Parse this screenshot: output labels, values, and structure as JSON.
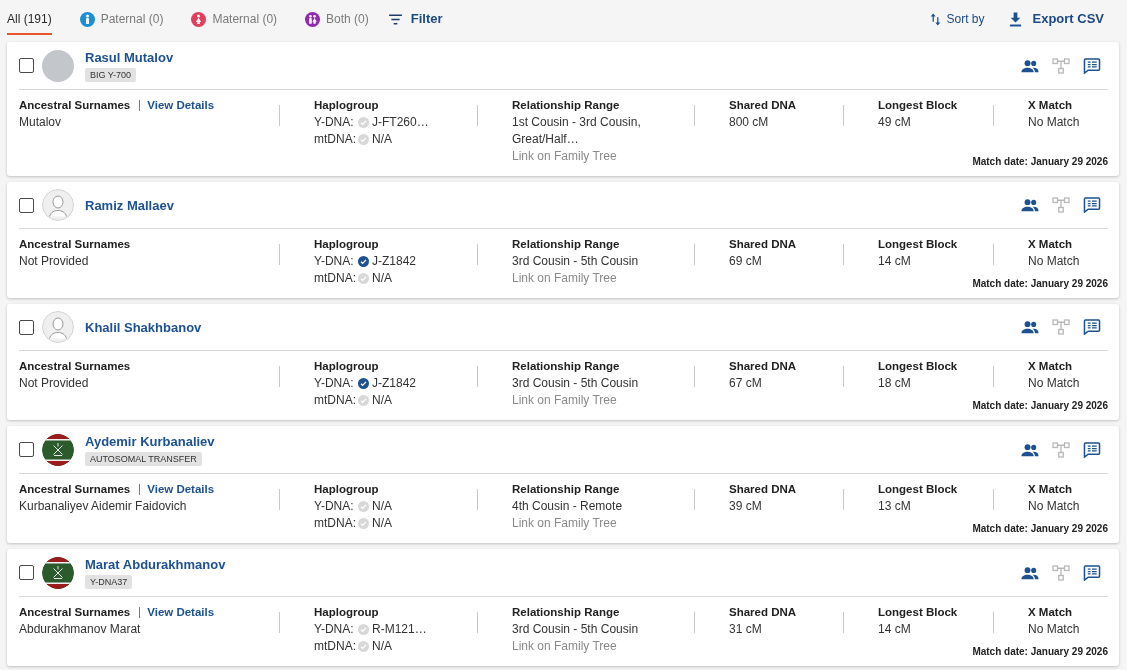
{
  "tabs": [
    {
      "kind": "all",
      "label": "All (191)",
      "selected": true
    },
    {
      "kind": "paternal",
      "label": "Paternal (0)",
      "selected": false,
      "color": "#1b8fd2"
    },
    {
      "kind": "maternal",
      "label": "Maternal (0)",
      "selected": false,
      "color": "#e23d5a"
    },
    {
      "kind": "both",
      "label": "Both (0)",
      "selected": false,
      "color": "#9428b0"
    }
  ],
  "filter": {
    "label": "Filter"
  },
  "actions": [
    {
      "kind": "sort",
      "label": "Sort by"
    },
    {
      "kind": "export",
      "label": "Export CSV"
    }
  ],
  "matches": [
    {
      "checked": false,
      "avatar": {
        "kind": "photo"
      },
      "name": "Rasul Mutalov",
      "badge": "BIG Y-700",
      "tree_linked": false,
      "surnames": {
        "label": "Ancestral Surnames",
        "link": "View Details",
        "value": "Mutalov"
      },
      "haplogroup": {
        "label": "Haplogroup",
        "y_dna": {
          "label": "Y-DNA:",
          "value": "J-FT260…",
          "verified": false
        },
        "mt_dna": {
          "label": "mtDNA:",
          "value": "N/A",
          "verified": false
        }
      },
      "relationship": {
        "label": "Relationship Range",
        "value": "1st Cousin - 3rd Cousin, Great/Half…",
        "link": "Link on Family Tree"
      },
      "shared_dna": {
        "label": "Shared DNA",
        "value": "800 cM"
      },
      "longest_block": {
        "label": "Longest Block",
        "value": "49 cM"
      },
      "x_match": {
        "label": "X Match",
        "value": "No Match"
      },
      "match_date": "Match date: January 29 2026"
    },
    {
      "checked": false,
      "avatar": {
        "kind": "silhouette"
      },
      "name": "Ramiz Mallaev",
      "tree_linked": false,
      "surnames": {
        "label": "Ancestral Surnames",
        "value": "Not Provided"
      },
      "haplogroup": {
        "label": "Haplogroup",
        "y_dna": {
          "label": "Y-DNA:",
          "value": "J-Z1842",
          "verified": true
        },
        "mt_dna": {
          "label": "mtDNA:",
          "value": "N/A",
          "verified": false
        }
      },
      "relationship": {
        "label": "Relationship Range",
        "value": "3rd Cousin - 5th Cousin",
        "link": "Link on Family Tree"
      },
      "shared_dna": {
        "label": "Shared DNA",
        "value": "69 cM"
      },
      "longest_block": {
        "label": "Longest Block",
        "value": "14 cM"
      },
      "x_match": {
        "label": "X Match",
        "value": "No Match"
      },
      "match_date": "Match date: January 29 2026"
    },
    {
      "checked": false,
      "avatar": {
        "kind": "silhouette"
      },
      "name": "Khalil Shakhbanov",
      "tree_linked": false,
      "surnames": {
        "label": "Ancestral Surnames",
        "value": "Not Provided"
      },
      "haplogroup": {
        "label": "Haplogroup",
        "y_dna": {
          "label": "Y-DNA:",
          "value": "J-Z1842",
          "verified": true
        },
        "mt_dna": {
          "label": "mtDNA:",
          "value": "N/A",
          "verified": false
        }
      },
      "relationship": {
        "label": "Relationship Range",
        "value": "3rd Cousin - 5th Cousin",
        "link": "Link on Family Tree"
      },
      "shared_dna": {
        "label": "Shared DNA",
        "value": "67 cM"
      },
      "longest_block": {
        "label": "Longest Block",
        "value": "18 cM"
      },
      "x_match": {
        "label": "X Match",
        "value": "No Match"
      },
      "match_date": "Match date: January 29 2026"
    },
    {
      "checked": false,
      "avatar": {
        "kind": "flag"
      },
      "name": "Aydemir Kurbanaliev",
      "badge": "AUTOSOMAL TRANSFER",
      "tree_linked": false,
      "surnames": {
        "label": "Ancestral Surnames",
        "link": "View Details",
        "value": "Kurbanaliyev Aidemir Faidovich"
      },
      "haplogroup": {
        "label": "Haplogroup",
        "y_dna": {
          "label": "Y-DNA:",
          "value": "N/A",
          "verified": false
        },
        "mt_dna": {
          "label": "mtDNA:",
          "value": "N/A",
          "verified": false
        }
      },
      "relationship": {
        "label": "Relationship Range",
        "value": "4th Cousin - Remote",
        "link": "Link on Family Tree"
      },
      "shared_dna": {
        "label": "Shared DNA",
        "value": "39 cM"
      },
      "longest_block": {
        "label": "Longest Block",
        "value": "13 cM"
      },
      "x_match": {
        "label": "X Match",
        "value": "No Match"
      },
      "match_date": "Match date: January 29 2026"
    },
    {
      "checked": false,
      "avatar": {
        "kind": "flag"
      },
      "name": "Marat Abdurakhmanov",
      "badge": "Y-DNA37",
      "tree_linked": false,
      "surnames": {
        "label": "Ancestral Surnames",
        "link": "View Details",
        "value": "Abdurakhmanov Marat"
      },
      "haplogroup": {
        "label": "Haplogroup",
        "y_dna": {
          "label": "Y-DNA:",
          "value": "R-M121…",
          "verified": false
        },
        "mt_dna": {
          "label": "mtDNA:",
          "value": "N/A",
          "verified": false
        }
      },
      "relationship": {
        "label": "Relationship Range",
        "value": "3rd Cousin - 5th Cousin",
        "link": "Link on Family Tree"
      },
      "shared_dna": {
        "label": "Shared DNA",
        "value": "31 cM"
      },
      "longest_block": {
        "label": "Longest Block",
        "value": "14 cM"
      },
      "x_match": {
        "label": "X Match",
        "value": "No Match"
      },
      "match_date": "Match date: January 29 2026"
    }
  ]
}
